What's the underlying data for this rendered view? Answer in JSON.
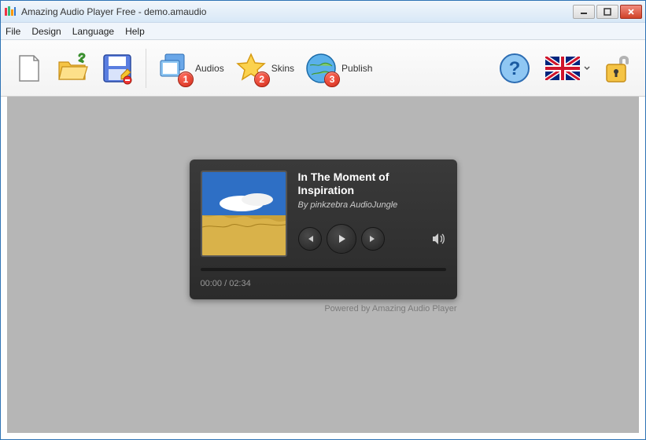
{
  "window": {
    "title": "Amazing Audio Player Free - demo.amaudio"
  },
  "menu": {
    "file": "File",
    "design": "Design",
    "language": "Language",
    "help": "Help"
  },
  "toolbar": {
    "audios": {
      "label": "Audios",
      "badge": "1"
    },
    "skins": {
      "label": "Skins",
      "badge": "2"
    },
    "publish": {
      "label": "Publish",
      "badge": "3"
    }
  },
  "player": {
    "title": "In The Moment of Inspiration",
    "artist": "By pinkzebra AudioJungle",
    "time": "00:00 / 02:34",
    "powered": "Powered by Amazing Audio Player"
  }
}
